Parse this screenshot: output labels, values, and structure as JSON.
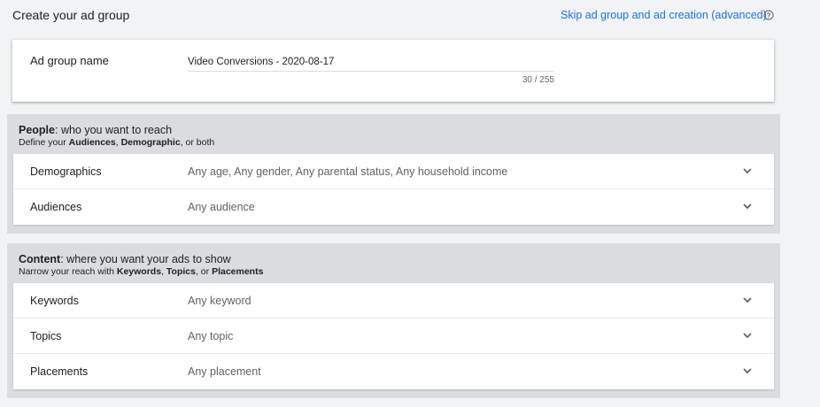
{
  "header": {
    "title": "Create your ad group",
    "skip_link": "Skip ad group and ad creation (advanced)",
    "help_icon": "help-circle-icon"
  },
  "ad_group": {
    "label": "Ad group name",
    "value": "Video Conversions - 2020-08-17",
    "char_count": "30 / 255"
  },
  "people": {
    "title_bold": "People",
    "title_rest": ": who you want to reach",
    "sub_prefix": "Define your ",
    "sub_bold1": "Audiences",
    "sub_sep": ", ",
    "sub_bold2": "Demographic",
    "sub_suffix": ", or both",
    "rows": [
      {
        "label": "Demographics",
        "value": "Any age, Any gender, Any parental status, Any household income"
      },
      {
        "label": "Audiences",
        "value": "Any audience"
      }
    ]
  },
  "content": {
    "title_bold": "Content",
    "title_rest": ": where you want your ads to show",
    "sub_prefix": "Narrow your reach with ",
    "sub_bold1": "Keywords",
    "sub_sep1": ", ",
    "sub_bold2": "Topics",
    "sub_sep2": ", or ",
    "sub_bold3": "Placements",
    "rows": [
      {
        "label": "Keywords",
        "value": "Any keyword"
      },
      {
        "label": "Topics",
        "value": "Any topic"
      },
      {
        "label": "Placements",
        "value": "Any placement"
      }
    ]
  },
  "colors": {
    "link": "#1a73e8",
    "page_bg": "#f1f3f4",
    "section_bg": "#dadce0",
    "muted_text": "#5f6368"
  }
}
